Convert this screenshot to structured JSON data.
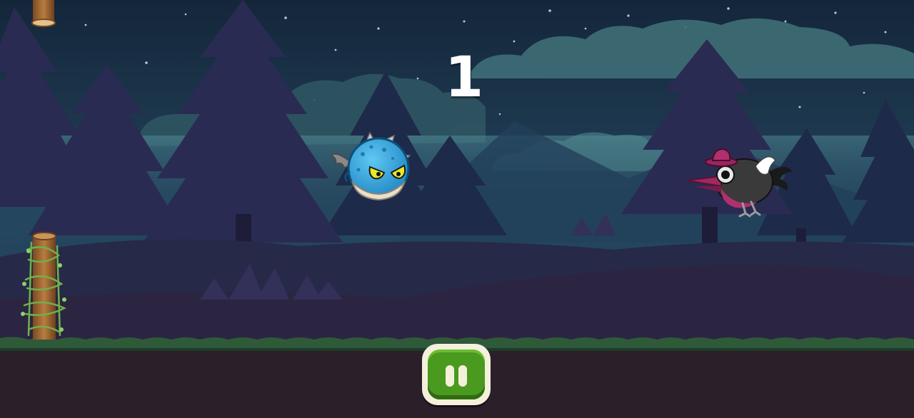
{
  "hud": {
    "score": "1"
  },
  "controls": {
    "pause_icon": "pause-icon"
  },
  "colors": {
    "sky": "#1f3a52",
    "ground": "#2b1f2a",
    "grass": "#2f5a3a",
    "pause_green": "#4a9a1f",
    "pause_frame": "#f4f0dc"
  },
  "sprites": {
    "player": "blue-spiked-dragon-ball",
    "enemy": "crow-with-hat",
    "obstacle": "wooden-log-pillar"
  }
}
